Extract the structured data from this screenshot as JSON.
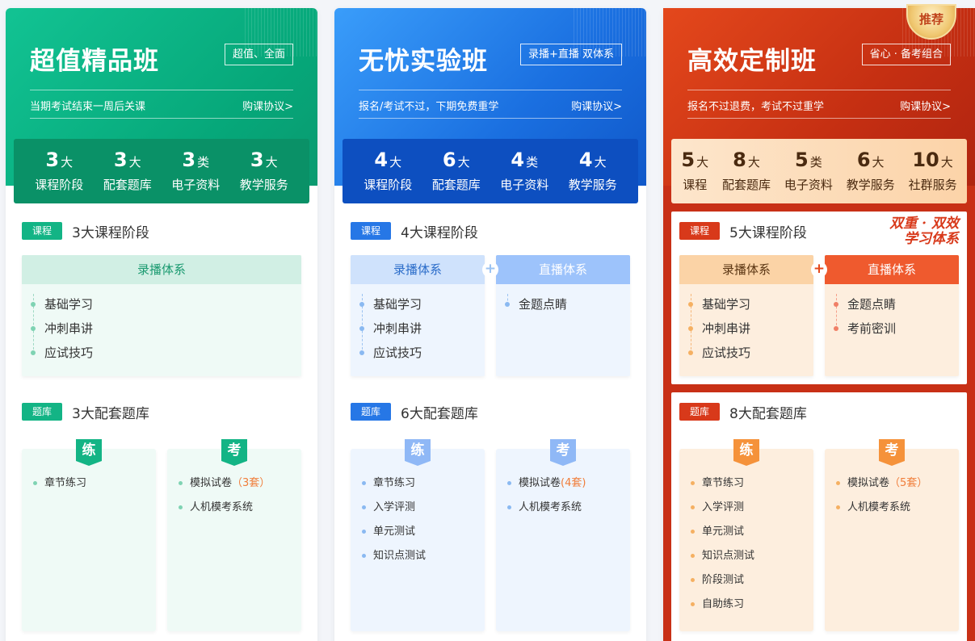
{
  "cards": [
    {
      "title": "超值精品班",
      "tag": "超值、全面",
      "note": "当期考试结束一周后关课",
      "agreement": "购课协议>",
      "stats": [
        {
          "num": "3",
          "unit": "大",
          "label": "课程阶段"
        },
        {
          "num": "3",
          "unit": "大",
          "label": "配套题库"
        },
        {
          "num": "3",
          "unit": "类",
          "label": "电子资料"
        },
        {
          "num": "3",
          "unit": "大",
          "label": "教学服务"
        }
      ],
      "course": {
        "badge": "课程",
        "title": "3大课程阶段",
        "recorded": {
          "label": "录播体系",
          "items": [
            "基础学习",
            "冲刺串讲",
            "应试技巧"
          ]
        }
      },
      "bank": {
        "badge": "题库",
        "title": "3大配套题库",
        "practice": {
          "icon": "练",
          "items": [
            "章节练习"
          ]
        },
        "exam": {
          "icon": "考",
          "item1": "模拟试卷",
          "item1_hl": "（3套）",
          "item2": "人机模考系统"
        }
      }
    },
    {
      "title": "无忧实验班",
      "tag": "录播+直播 双体系",
      "note": "报名/考试不过，下期免费重学",
      "agreement": "购课协议>",
      "stats": [
        {
          "num": "4",
          "unit": "大",
          "label": "课程阶段"
        },
        {
          "num": "6",
          "unit": "大",
          "label": "配套题库"
        },
        {
          "num": "4",
          "unit": "类",
          "label": "电子资料"
        },
        {
          "num": "4",
          "unit": "大",
          "label": "教学服务"
        }
      ],
      "course": {
        "badge": "课程",
        "title": "4大课程阶段",
        "recorded": {
          "label": "录播体系",
          "items": [
            "基础学习",
            "冲刺串讲",
            "应试技巧"
          ]
        },
        "live": {
          "label": "直播体系",
          "items": [
            "金题点睛"
          ]
        }
      },
      "bank": {
        "badge": "题库",
        "title": "6大配套题库",
        "practice": {
          "icon": "练",
          "items": [
            "章节练习",
            "入学评测",
            "单元测试",
            "知识点测试"
          ]
        },
        "exam": {
          "icon": "考",
          "item1": "模拟试卷",
          "item1_hl": "(4套)",
          "item2": "人机模考系统"
        }
      }
    },
    {
      "title": "高效定制班",
      "tag": "省心 · 备考组合",
      "note": "报名不过退费，考试不过重学",
      "agreement": "购课协议>",
      "ribbon": "推荐",
      "dual_line1": "双重 · 双效",
      "dual_line2": "学习体系",
      "stats": [
        {
          "num": "5",
          "unit": "大",
          "label": "课程"
        },
        {
          "num": "8",
          "unit": "大",
          "label": "配套题库"
        },
        {
          "num": "5",
          "unit": "类",
          "label": "电子资料"
        },
        {
          "num": "6",
          "unit": "大",
          "label": "教学服务"
        },
        {
          "num": "10",
          "unit": "大",
          "label": "社群服务"
        }
      ],
      "course": {
        "badge": "课程",
        "title": "5大课程阶段",
        "recorded": {
          "label": "录播体系",
          "items": [
            "基础学习",
            "冲刺串讲",
            "应试技巧"
          ]
        },
        "live": {
          "label": "直播体系",
          "items": [
            "金题点睛",
            "考前密训"
          ]
        }
      },
      "bank": {
        "badge": "题库",
        "title": "8大配套题库",
        "practice": {
          "icon": "练",
          "items": [
            "章节练习",
            "入学评测",
            "单元测试",
            "知识点测试",
            "阶段测试",
            "自助练习"
          ]
        },
        "exam": {
          "icon": "考",
          "item1": "模拟试卷",
          "item1_hl": "（5套）",
          "item2": "人机模考系统"
        }
      }
    }
  ],
  "plus_sign": "+",
  "colors": {
    "green": "#13b485",
    "blue": "#2677e6",
    "red": "#d8391a",
    "orange": "#f5a03a"
  }
}
